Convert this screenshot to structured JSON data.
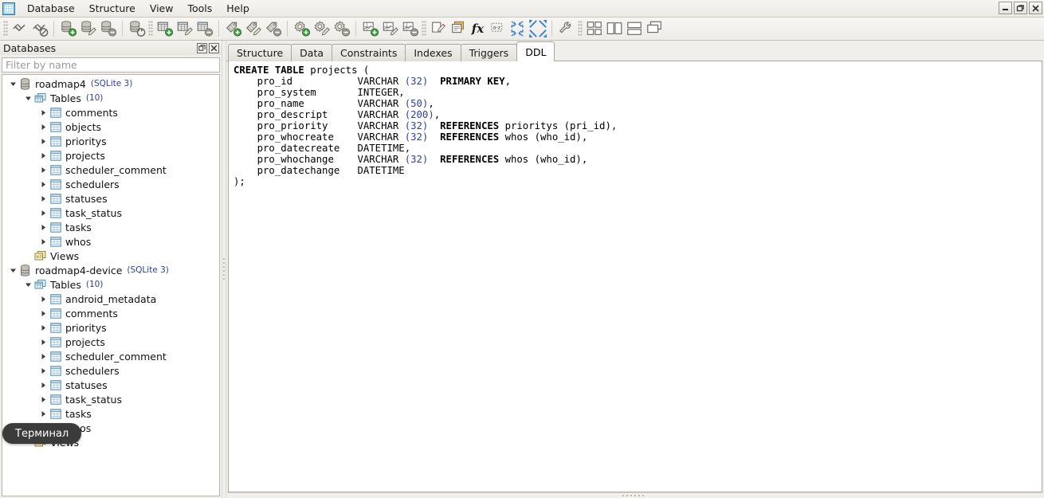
{
  "window": {
    "app_icon": "app-grid-icon",
    "controls": [
      {
        "name": "minimize",
        "glyph": "minimize-icon"
      },
      {
        "name": "restore",
        "glyph": "restore-icon"
      },
      {
        "name": "close",
        "glyph": "close-icon"
      }
    ]
  },
  "menubar": {
    "items": [
      {
        "label": "Database"
      },
      {
        "label": "Structure"
      },
      {
        "label": "View"
      },
      {
        "label": "Tools"
      },
      {
        "label": "Help"
      }
    ]
  },
  "toolbar": {
    "groups": [
      {
        "buttons": [
          {
            "name": "connect-icon",
            "kind": "plug",
            "badge": "none"
          },
          {
            "name": "disconnect-icon",
            "kind": "plug",
            "badge": "deny"
          }
        ]
      },
      {
        "buttons": [
          {
            "name": "add-database-icon",
            "kind": "db",
            "badge": "add"
          },
          {
            "name": "edit-database-icon",
            "kind": "db",
            "badge": "edit"
          },
          {
            "name": "remove-database-icon",
            "kind": "db",
            "badge": "remove"
          }
        ]
      },
      {
        "buttons": [
          {
            "name": "refresh-database-icon",
            "kind": "db",
            "badge": "refresh"
          }
        ]
      },
      {
        "buttons": [
          {
            "name": "add-table-icon",
            "kind": "table",
            "badge": "add"
          },
          {
            "name": "edit-table-icon",
            "kind": "table",
            "badge": "edit"
          },
          {
            "name": "remove-table-icon",
            "kind": "table",
            "badge": "remove"
          }
        ]
      },
      {
        "buttons": [
          {
            "name": "add-index-icon",
            "kind": "tag",
            "badge": "add"
          },
          {
            "name": "edit-index-icon",
            "kind": "tag",
            "badge": "edit"
          },
          {
            "name": "remove-index-icon",
            "kind": "tag",
            "badge": "remove"
          }
        ]
      },
      {
        "buttons": [
          {
            "name": "add-trigger-icon",
            "kind": "gear",
            "badge": "add"
          },
          {
            "name": "edit-trigger-icon",
            "kind": "gear",
            "badge": "edit"
          },
          {
            "name": "remove-trigger-icon",
            "kind": "gear",
            "badge": "remove"
          }
        ]
      },
      {
        "buttons": [
          {
            "name": "add-view-icon",
            "kind": "view",
            "badge": "add"
          },
          {
            "name": "edit-view-icon",
            "kind": "view",
            "badge": "edit"
          },
          {
            "name": "remove-view-icon",
            "kind": "view",
            "badge": "remove"
          }
        ]
      },
      {
        "buttons": [
          {
            "name": "new-query-icon",
            "kind": "note"
          },
          {
            "name": "query-builder-icon",
            "kind": "notestack"
          },
          {
            "name": "function-icon",
            "kind": "fx",
            "text": "fx"
          },
          {
            "name": "sort-az-icon",
            "kind": "az",
            "text": "a-z"
          },
          {
            "name": "collapse-all-icon",
            "kind": "collapse"
          },
          {
            "name": "expand-all-icon",
            "kind": "expand"
          }
        ]
      },
      {
        "buttons": [
          {
            "name": "preferences-icon",
            "kind": "wrench"
          }
        ]
      },
      {
        "buttons": [
          {
            "name": "tile-grid-icon",
            "kind": "tilegrid"
          },
          {
            "name": "tile-vertical-icon",
            "kind": "tilevert"
          },
          {
            "name": "tile-horizontal-icon",
            "kind": "tilehoriz"
          },
          {
            "name": "cascade-icon",
            "kind": "cascade"
          }
        ]
      }
    ]
  },
  "sidebar": {
    "title": "Databases",
    "title_buttons": [
      {
        "name": "float-panel",
        "glyph": "float-icon"
      },
      {
        "name": "close-panel",
        "glyph": "close-icon"
      }
    ],
    "filter": {
      "value": "",
      "placeholder": "Filter by name"
    },
    "tree": [
      {
        "depth": 0,
        "twisty": "open",
        "icon": "database-icon",
        "label": "roadmap4",
        "sub": "(SQLite 3)"
      },
      {
        "depth": 1,
        "twisty": "open",
        "icon": "tables-folder-icon",
        "label": "Tables",
        "sub": "(10)"
      },
      {
        "depth": 2,
        "twisty": "closed",
        "icon": "table-icon",
        "label": "comments",
        "sub": ""
      },
      {
        "depth": 2,
        "twisty": "closed",
        "icon": "table-icon",
        "label": "objects",
        "sub": ""
      },
      {
        "depth": 2,
        "twisty": "closed",
        "icon": "table-icon",
        "label": "prioritys",
        "sub": ""
      },
      {
        "depth": 2,
        "twisty": "closed",
        "icon": "table-icon",
        "label": "projects",
        "sub": ""
      },
      {
        "depth": 2,
        "twisty": "closed",
        "icon": "table-icon",
        "label": "scheduler_comment",
        "sub": ""
      },
      {
        "depth": 2,
        "twisty": "closed",
        "icon": "table-icon",
        "label": "schedulers",
        "sub": ""
      },
      {
        "depth": 2,
        "twisty": "closed",
        "icon": "table-icon",
        "label": "statuses",
        "sub": ""
      },
      {
        "depth": 2,
        "twisty": "closed",
        "icon": "table-icon",
        "label": "task_status",
        "sub": ""
      },
      {
        "depth": 2,
        "twisty": "closed",
        "icon": "table-icon",
        "label": "tasks",
        "sub": ""
      },
      {
        "depth": 2,
        "twisty": "closed",
        "icon": "table-icon",
        "label": "whos",
        "sub": ""
      },
      {
        "depth": 1,
        "twisty": "none",
        "icon": "views-folder-icon",
        "label": "Views",
        "sub": ""
      },
      {
        "depth": 0,
        "twisty": "open",
        "icon": "database-icon",
        "label": "roadmap4-device",
        "sub": "(SQLite 3)"
      },
      {
        "depth": 1,
        "twisty": "open",
        "icon": "tables-folder-icon",
        "label": "Tables",
        "sub": "(10)"
      },
      {
        "depth": 2,
        "twisty": "closed",
        "icon": "table-icon",
        "label": "android_metadata",
        "sub": ""
      },
      {
        "depth": 2,
        "twisty": "closed",
        "icon": "table-icon",
        "label": "comments",
        "sub": ""
      },
      {
        "depth": 2,
        "twisty": "closed",
        "icon": "table-icon",
        "label": "prioritys",
        "sub": ""
      },
      {
        "depth": 2,
        "twisty": "closed",
        "icon": "table-icon",
        "label": "projects",
        "sub": ""
      },
      {
        "depth": 2,
        "twisty": "closed",
        "icon": "table-icon",
        "label": "scheduler_comment",
        "sub": ""
      },
      {
        "depth": 2,
        "twisty": "closed",
        "icon": "table-icon",
        "label": "schedulers",
        "sub": ""
      },
      {
        "depth": 2,
        "twisty": "closed",
        "icon": "table-icon",
        "label": "statuses",
        "sub": ""
      },
      {
        "depth": 2,
        "twisty": "closed",
        "icon": "table-icon",
        "label": "task_status",
        "sub": ""
      },
      {
        "depth": 2,
        "twisty": "closed",
        "icon": "table-icon",
        "label": "tasks",
        "sub": ""
      },
      {
        "depth": 2,
        "twisty": "closed",
        "icon": "table-icon",
        "label": "whos",
        "sub": ""
      },
      {
        "depth": 1,
        "twisty": "none",
        "icon": "views-folder-icon",
        "label": "Views",
        "sub": ""
      }
    ]
  },
  "main": {
    "tabs": [
      {
        "label": "Structure",
        "active": false
      },
      {
        "label": "Data",
        "active": false
      },
      {
        "label": "Constraints",
        "active": false
      },
      {
        "label": "Indexes",
        "active": false
      },
      {
        "label": "Triggers",
        "active": false
      },
      {
        "label": "DDL",
        "active": true
      }
    ],
    "ddl_lines": [
      [
        {
          "t": "CREATE TABLE",
          "s": "kw"
        },
        {
          "t": " projects (",
          "s": "plain"
        }
      ],
      [
        {
          "t": "    pro_id           VARCHAR ",
          "s": "plain"
        },
        {
          "t": "(32)",
          "s": "num"
        },
        {
          "t": "  ",
          "s": "plain"
        },
        {
          "t": "PRIMARY KEY",
          "s": "kw"
        },
        {
          "t": ",",
          "s": "plain"
        }
      ],
      [
        {
          "t": "    pro_system       INTEGER,",
          "s": "plain"
        }
      ],
      [
        {
          "t": "    pro_name         VARCHAR ",
          "s": "plain"
        },
        {
          "t": "(50)",
          "s": "num"
        },
        {
          "t": ",",
          "s": "plain"
        }
      ],
      [
        {
          "t": "    pro_descript     VARCHAR ",
          "s": "plain"
        },
        {
          "t": "(200)",
          "s": "num"
        },
        {
          "t": ",",
          "s": "plain"
        }
      ],
      [
        {
          "t": "    pro_priority     VARCHAR ",
          "s": "plain"
        },
        {
          "t": "(32)",
          "s": "num"
        },
        {
          "t": "  ",
          "s": "plain"
        },
        {
          "t": "REFERENCES",
          "s": "kw"
        },
        {
          "t": " prioritys (pri_id),",
          "s": "plain"
        }
      ],
      [
        {
          "t": "    pro_whocreate    VARCHAR ",
          "s": "plain"
        },
        {
          "t": "(32)",
          "s": "num"
        },
        {
          "t": "  ",
          "s": "plain"
        },
        {
          "t": "REFERENCES",
          "s": "kw"
        },
        {
          "t": " whos (who_id),",
          "s": "plain"
        }
      ],
      [
        {
          "t": "    pro_datecreate   DATETIME,",
          "s": "plain"
        }
      ],
      [
        {
          "t": "    pro_whochange    VARCHAR ",
          "s": "plain"
        },
        {
          "t": "(32)",
          "s": "num"
        },
        {
          "t": "  ",
          "s": "plain"
        },
        {
          "t": "REFERENCES",
          "s": "kw"
        },
        {
          "t": " whos (who_id),",
          "s": "plain"
        }
      ],
      [
        {
          "t": "    pro_datechange   DATETIME",
          "s": "plain"
        }
      ],
      [
        {
          "t": ");",
          "s": "plain"
        }
      ]
    ]
  },
  "tooltip": {
    "text": "Терминал"
  },
  "colors": {
    "accent_blue": "#2b3f9e",
    "tooltip_bg": "#3b3b3b",
    "chrome_bg": "#f0efeb",
    "icon_blue": "#3d7fd1",
    "icon_green": "#3fa03f"
  }
}
